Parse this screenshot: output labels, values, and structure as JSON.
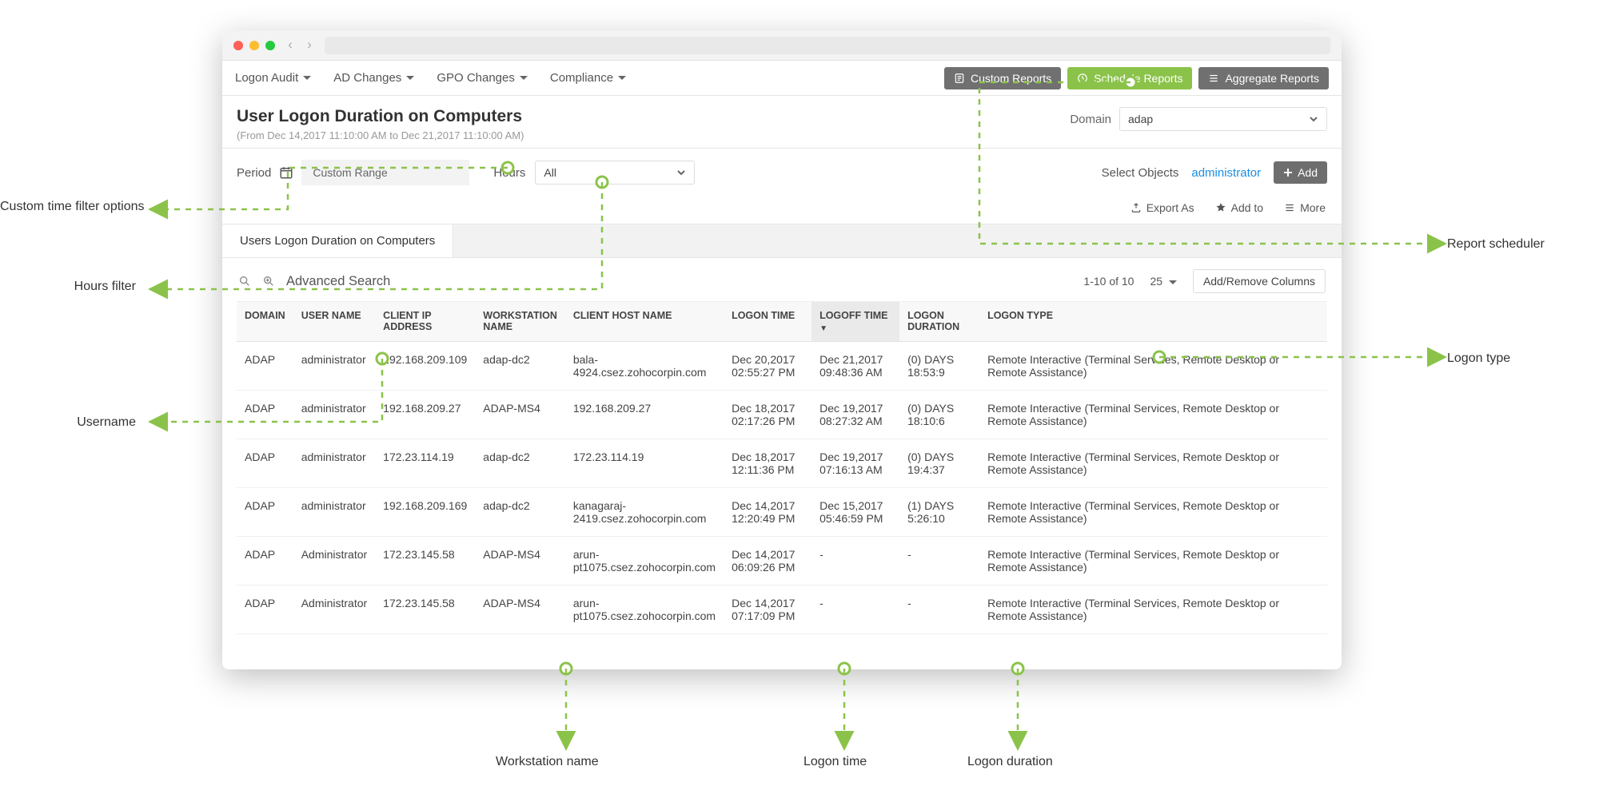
{
  "topTabs": {
    "logon": "Logon Audit",
    "ad": "AD Changes",
    "gpo": "GPO Changes",
    "compliance": "Compliance"
  },
  "topButtons": {
    "custom": "Custom Reports",
    "schedule": "Schedule Reports",
    "aggregate": "Aggregate Reports"
  },
  "page": {
    "title": "User Logon Duration on Computers",
    "subtitle": "(From Dec 14,2017 11:10:00 AM to Dec 21,2017 11:10:00 AM)"
  },
  "domain": {
    "label": "Domain",
    "value": "adap"
  },
  "filters": {
    "periodLabel": "Period",
    "periodValue": "Custom Range",
    "hoursLabel": "Hours",
    "hoursValue": "All",
    "selectObjectsLabel": "Select Objects",
    "objectLink": "administrator",
    "addLabel": "Add"
  },
  "actionLinks": {
    "export": "Export As",
    "addTo": "Add to",
    "more": "More"
  },
  "subtab": "Users Logon Duration on Computers",
  "toolbar": {
    "advSearch": "Advanced Search",
    "range": "1-10 of 10",
    "pageSize": "25",
    "addRemoveCols": "Add/Remove Columns"
  },
  "columns": [
    "DOMAIN",
    "USER NAME",
    "CLIENT IP ADDRESS",
    "WORKSTATION NAME",
    "CLIENT HOST NAME",
    "LOGON TIME",
    "LOGOFF TIME",
    "LOGON DURATION",
    "LOGON TYPE"
  ],
  "sortedCol": 6,
  "rows": [
    {
      "domain": "ADAP",
      "user": "administrator",
      "ip": "192.168.209.109",
      "ws": "adap-dc2",
      "host": "bala-4924.csez.zohocorpin.com",
      "logon": "Dec 20,2017 02:55:27 PM",
      "logoff": "Dec 21,2017 09:48:36 AM",
      "dur": "(0) DAYS 18:53:9",
      "type": "Remote Interactive (Terminal Services, Remote Desktop or Remote Assistance)"
    },
    {
      "domain": "ADAP",
      "user": "administrator",
      "ip": "192.168.209.27",
      "ws": "ADAP-MS4",
      "host": "192.168.209.27",
      "logon": "Dec 18,2017 02:17:26 PM",
      "logoff": "Dec 19,2017 08:27:32 AM",
      "dur": "(0) DAYS 18:10:6",
      "type": "Remote Interactive (Terminal Services, Remote Desktop or Remote Assistance)"
    },
    {
      "domain": "ADAP",
      "user": "administrator",
      "ip": "172.23.114.19",
      "ws": "adap-dc2",
      "host": "172.23.114.19",
      "logon": "Dec 18,2017 12:11:36 PM",
      "logoff": "Dec 19,2017 07:16:13 AM",
      "dur": "(0) DAYS 19:4:37",
      "type": "Remote Interactive (Terminal Services, Remote Desktop or Remote Assistance)"
    },
    {
      "domain": "ADAP",
      "user": "administrator",
      "ip": "192.168.209.169",
      "ws": "adap-dc2",
      "host": "kanagaraj-2419.csez.zohocorpin.com",
      "logon": "Dec 14,2017 12:20:49 PM",
      "logoff": "Dec 15,2017 05:46:59 PM",
      "dur": "(1) DAYS 5:26:10",
      "type": "Remote Interactive (Terminal Services, Remote Desktop or Remote Assistance)"
    },
    {
      "domain": "ADAP",
      "user": "Administrator",
      "ip": "172.23.145.58",
      "ws": "ADAP-MS4",
      "host": "arun-pt1075.csez.zohocorpin.com",
      "logon": "Dec 14,2017 06:09:26 PM",
      "logoff": "-",
      "dur": "-",
      "type": "Remote Interactive (Terminal Services, Remote Desktop or Remote Assistance)"
    },
    {
      "domain": "ADAP",
      "user": "Administrator",
      "ip": "172.23.145.58",
      "ws": "ADAP-MS4",
      "host": "arun-pt1075.csez.zohocorpin.com",
      "logon": "Dec 14,2017 07:17:09 PM",
      "logoff": "-",
      "dur": "-",
      "type": "Remote Interactive (Terminal Services, Remote Desktop or Remote Assistance)"
    }
  ],
  "annotations": {
    "period": "Custom time filter options",
    "hours": "Hours filter",
    "schedule": "Report scheduler",
    "user": "Username",
    "workstation": "Workstation name",
    "logon": "Logon time",
    "duration": "Logon duration",
    "logontype": "Logon type"
  }
}
